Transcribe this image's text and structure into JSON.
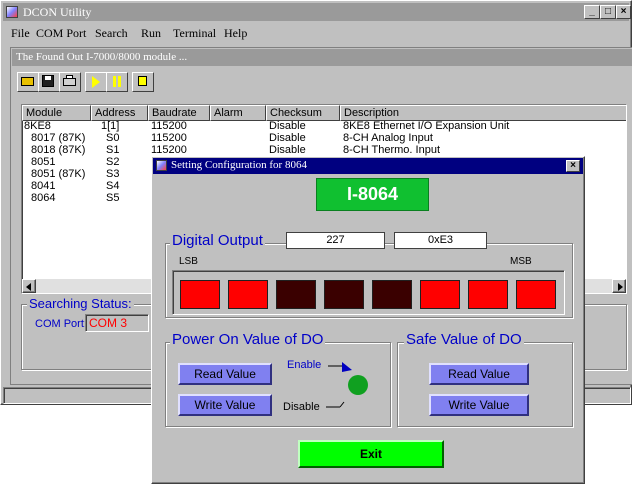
{
  "main_window": {
    "title": "DCON Utility",
    "menu": [
      "File",
      "COM Port",
      "Search",
      "Run",
      "Terminal",
      "Help"
    ],
    "window_buttons": [
      "_",
      "□",
      "×"
    ]
  },
  "module_panel": {
    "title": "The Found Out I-7000/8000 module ..."
  },
  "table": {
    "columns": [
      "Module",
      "Address",
      "Baudrate",
      "Alarm",
      "Checksum",
      "Description"
    ],
    "rows": [
      {
        "module": "8KE8",
        "address": "1[1]",
        "baudrate": "115200",
        "alarm": "",
        "checksum": "Disable",
        "description": "8KE8 Ethernet I/O Expansion Unit"
      },
      {
        "module": "8017 (87K)",
        "address": "S0",
        "baudrate": "115200",
        "alarm": "",
        "checksum": "Disable",
        "description": "8-CH Analog Input"
      },
      {
        "module": "8018 (87K)",
        "address": "S1",
        "baudrate": "115200",
        "alarm": "",
        "checksum": "Disable",
        "description": "8-CH Thermo. Input"
      },
      {
        "module": "8051",
        "address": "S2",
        "baudrate": "",
        "alarm": "",
        "checksum": "",
        "description": ""
      },
      {
        "module": "8051 (87K)",
        "address": "S3",
        "baudrate": "",
        "alarm": "",
        "checksum": "",
        "description": ""
      },
      {
        "module": "8041",
        "address": "S4",
        "baudrate": "",
        "alarm": "",
        "checksum": "",
        "description": ""
      },
      {
        "module": "8064",
        "address": "S5",
        "baudrate": "",
        "alarm": "",
        "checksum": "",
        "description": ""
      }
    ]
  },
  "status": {
    "label": "Searching Status:",
    "com_port_label": "COM Port:",
    "com_port_value": "COM 3"
  },
  "dialog": {
    "title": "Setting Configuration for 8064",
    "close": "×",
    "module_name": "I-8064",
    "digital_output": {
      "label": "Digital Output",
      "decimal_value": "227",
      "hex_value": "0xE3",
      "lsb_label": "LSB",
      "msb_label": "MSB",
      "bits_lsb_first": [
        1,
        1,
        0,
        0,
        0,
        1,
        1,
        1
      ],
      "on_color": "#ff0000",
      "off_color": "#3a0000"
    },
    "power_on": {
      "label": "Power On Value of DO",
      "read_button": "Read Value",
      "write_button": "Write Value",
      "enable_label": "Enable",
      "disable_label": "Disable"
    },
    "safe_value": {
      "label": "Safe Value of DO",
      "read_button": "Read Value",
      "write_button": "Write Value"
    },
    "exit_button": "Exit"
  }
}
